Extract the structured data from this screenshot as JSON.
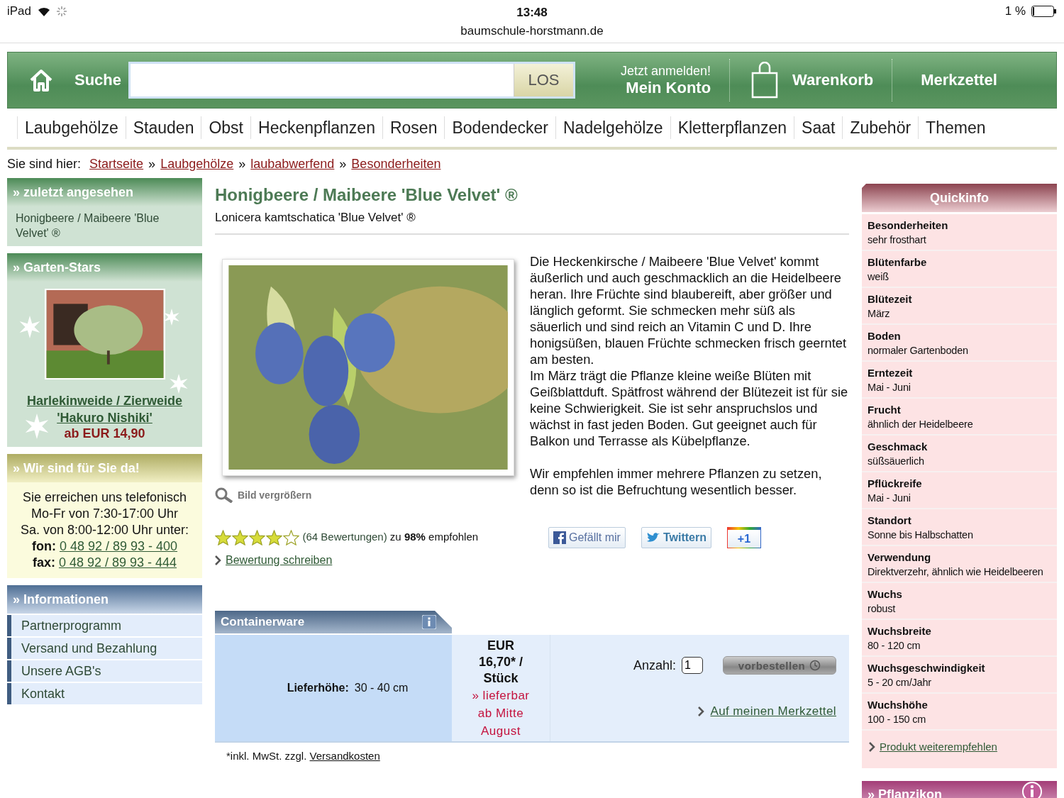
{
  "status_bar": {
    "device": "iPad",
    "time": "13:48",
    "url": "baumschule-horstmann.de",
    "battery": "1 %"
  },
  "header": {
    "search_label": "Suche",
    "search_button": "LOS",
    "login_hint": "Jetzt anmelden!",
    "account": "Mein Konto",
    "cart": "Warenkorb",
    "wishlist": "Merkzettel"
  },
  "categories": [
    "Laubgehölze",
    "Stauden",
    "Obst",
    "Heckenpflanzen",
    "Rosen",
    "Bodendecker",
    "Nadelgehölze",
    "Kletterpflanzen",
    "Saat",
    "Zubehör",
    "Themen"
  ],
  "breadcrumb": {
    "label": "Sie sind hier:",
    "separator": "»",
    "items": [
      "Startseite",
      "Laubgehölze",
      "laubabwerfend",
      "Besonderheiten"
    ]
  },
  "sidebar": {
    "recent": {
      "title": "» zuletzt angesehen",
      "item": "Honigbeere / Maibeere 'Blue Velvet' ®"
    },
    "garden_stars": {
      "title": "» Garten-Stars",
      "product": "Harlekinweide / Zierweide 'Hakuro Nishiki'",
      "price": "ab EUR 14,90"
    },
    "contact": {
      "title": "» Wir sind für Sie da!",
      "lines": [
        "Sie erreichen uns telefonisch",
        "Mo-Fr von 7:30-17:00 Uhr",
        "Sa. von 8:00-12:00 Uhr unter:"
      ],
      "phones": [
        {
          "label": "fon:",
          "number": "0 48 92 / 89 93 - 400"
        },
        {
          "label": "fax:",
          "number": "0 48 92 / 89 93 - 444"
        }
      ]
    },
    "info": {
      "title": "» Informationen",
      "items": [
        "Partnerprogramm",
        "Versand und Bezahlung",
        "Unsere AGB's",
        "Kontakt"
      ]
    }
  },
  "product": {
    "title": "Honigbeere / Maibeere 'Blue Velvet' ®",
    "latin": "Lonicera kamtschatica 'Blue Velvet' ®",
    "zoom_link": "Bild vergrößern",
    "description": [
      "Die Heckenkirsche / Maibeere 'Blue Velvet' kommt äußerlich und auch geschmacklich an die Heidelbeere heran. Ihre Früchte sind blaubereift, aber größer und länglich geformt. Sie schmecken mehr süß als säuerlich und sind reich an Vitamin C und D. Ihre honigsüßen, blauen Früchte schmecken frisch geerntet am besten.",
      "Im März trägt die Pflanze kleine weiße Blüten mit Geißblattduft. Spätfrost während der Blütezeit ist für sie keine Schwierigkeit. Sie ist sehr anspruchslos und wächst in fast jeden Boden. Gut geeignet auch für Balkon und Terrasse als Kübelpflanze.",
      "Wir empfehlen immer mehrere Pflanzen zu setzen, denn so ist die Befruchtung wesentlich besser."
    ],
    "rating": {
      "stars": 4,
      "count": "(64 Bewertungen)",
      "recommend": "zu **98%** empfohlen"
    },
    "write_review": "Bewertung schreiben",
    "social": [
      {
        "kind": "facebook",
        "label": "Gefällt mir"
      },
      {
        "kind": "twitter",
        "label": "Twittern"
      },
      {
        "kind": "gplus",
        "label": "+1"
      }
    ],
    "offer": {
      "type": "Containerware",
      "height_label": "Lieferhöhe:",
      "height": "30 - 40 cm",
      "price": "EUR 16,70* / Stück",
      "availability": "» lieferbar ab Mitte August",
      "quantity_label": "Anzahl:",
      "quantity": "1",
      "order_button": "vorbestellen",
      "wishlist_link": "Auf meinen Merkzettel"
    },
    "footnote": "*inkl. MwSt. zzgl.",
    "shipping_link": "Versandkosten"
  },
  "quickinfo": {
    "title": "Quickinfo",
    "items": [
      {
        "label": "Besonderheiten",
        "value": "sehr frosthart"
      },
      {
        "label": "Blütenfarbe",
        "value": "weiß"
      },
      {
        "label": "Blütezeit",
        "value": "März"
      },
      {
        "label": "Boden",
        "value": "normaler Gartenboden"
      },
      {
        "label": "Erntezeit",
        "value": "Mai - Juni"
      },
      {
        "label": "Frucht",
        "value": "ähnlich der Heidelbeere"
      },
      {
        "label": "Geschmack",
        "value": "süßsäuerlich"
      },
      {
        "label": "Pflückreife",
        "value": "Mai - Juni"
      },
      {
        "label": "Standort",
        "value": "Sonne bis Halbschatten"
      },
      {
        "label": "Verwendung",
        "value": "Direktverzehr, ähnlich wie Heidelbeeren"
      },
      {
        "label": "Wuchs",
        "value": "robust"
      },
      {
        "label": "Wuchsbreite",
        "value": "80 - 120 cm"
      },
      {
        "label": "Wuchsgeschwindigkeit",
        "value": "5 - 20 cm/Jahr"
      },
      {
        "label": "Wuchshöhe",
        "value": "100 - 150 cm"
      }
    ],
    "recommend_link": "Produkt weiterempfehlen"
  },
  "pflanzikon": {
    "title": "» Pflanzikon"
  }
}
